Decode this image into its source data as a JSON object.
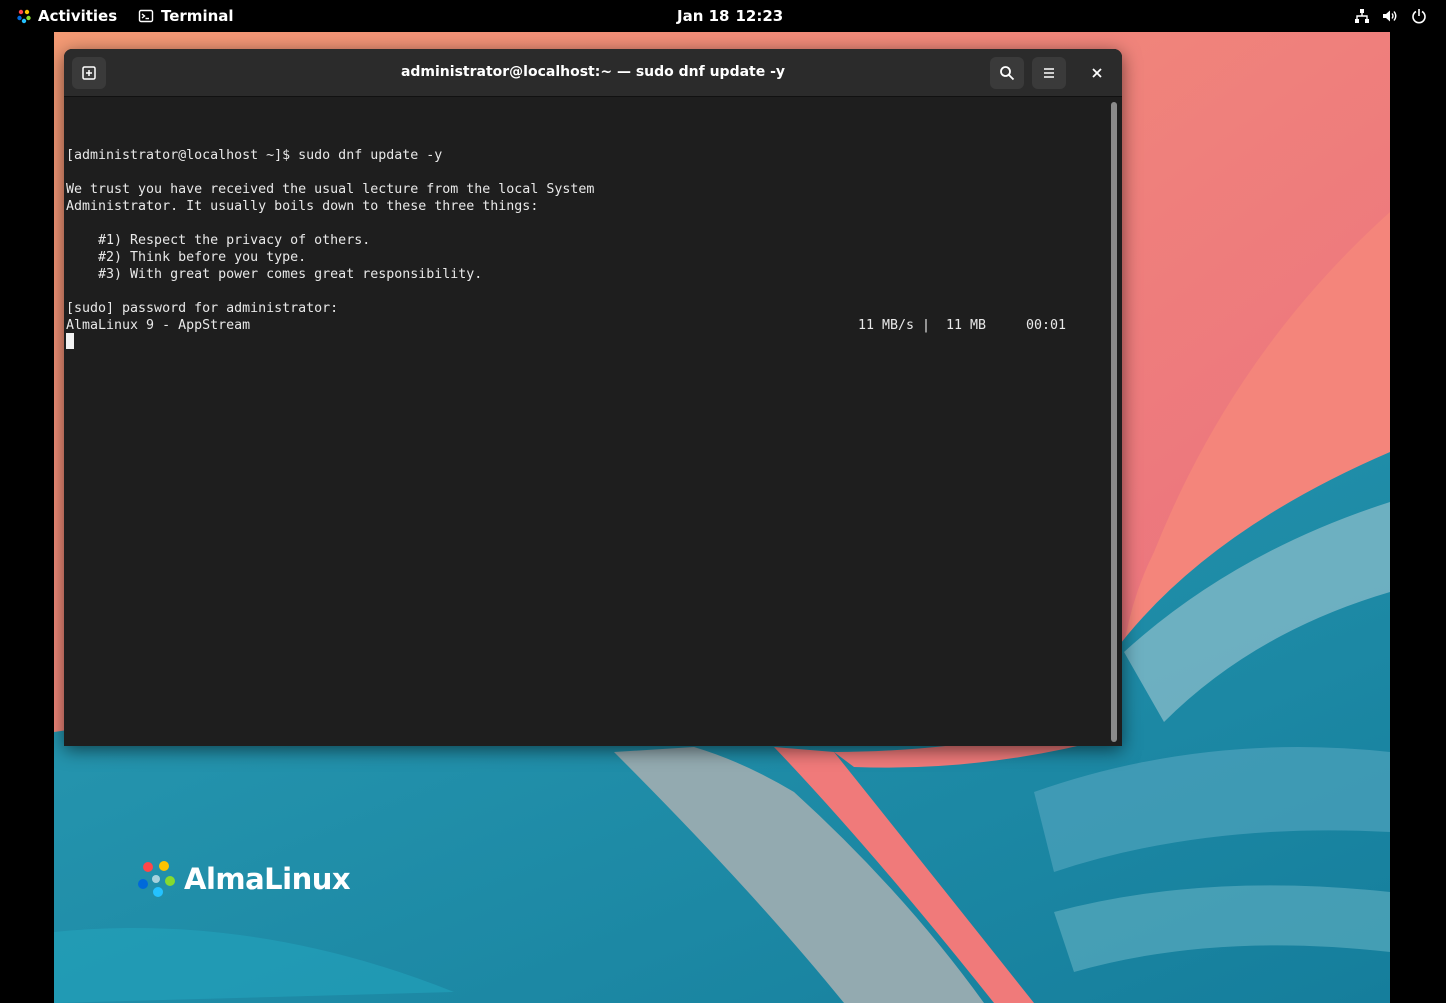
{
  "topbar": {
    "activities_label": "Activities",
    "app_label": "Terminal",
    "date": "Jan 18",
    "time": "12:23",
    "tray_icons": [
      "network-icon",
      "volume-icon",
      "power-icon"
    ]
  },
  "window": {
    "title": "administrator@localhost:~ — sudo dnf update -y",
    "buttons": {
      "new_tab": "new-tab-icon",
      "search": "search-icon",
      "menu": "hamburger-menu-icon",
      "close": "×"
    }
  },
  "terminal": {
    "lines": [
      "[administrator@localhost ~]$ sudo dnf update -y",
      "",
      "We trust you have received the usual lecture from the local System",
      "Administrator. It usually boils down to these three things:",
      "",
      "    #1) Respect the privacy of others.",
      "    #2) Think before you type.",
      "    #3) With great power comes great responsibility.",
      "",
      "[sudo] password for administrator:",
      "AlmaLinux 9 - AppStream"
    ],
    "progress": {
      "speed": "11 MB/s |",
      "size": "11 MB",
      "elapsed": "00:01"
    }
  },
  "desktop": {
    "brand_name": "AlmaLinux"
  },
  "colors": {
    "wallpaper_pink": "#f07f78",
    "wallpaper_teal": "#1d8fa8",
    "terminal_bg": "#1e1e1e",
    "headerbar_bg": "#2b2b2b"
  }
}
